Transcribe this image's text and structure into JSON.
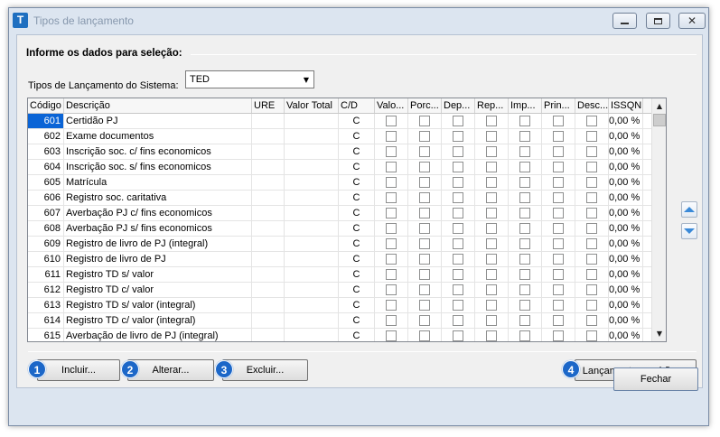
{
  "window": {
    "title": "Tipos de lançamento",
    "icon_letter": "T"
  },
  "form": {
    "group_title": "Informe os dados para seleção:",
    "select_label": "Tipos de Lançamento do Sistema:",
    "select_value": "TED"
  },
  "grid": {
    "columns": [
      "Código",
      "Descrição",
      "URE",
      "Valor Total",
      "C/D",
      "Valo...",
      "Porc...",
      "Dep...",
      "Rep...",
      "Imp...",
      "Prin...",
      "Desc...",
      "ISSQN"
    ],
    "rows": [
      {
        "code": "601",
        "desc": "Certidão PJ",
        "cd": "C",
        "issqn": "0,00 %"
      },
      {
        "code": "602",
        "desc": "Exame documentos",
        "cd": "C",
        "issqn": "0,00 %"
      },
      {
        "code": "603",
        "desc": "Inscrição soc. c/ fins economicos",
        "cd": "C",
        "issqn": "0,00 %"
      },
      {
        "code": "604",
        "desc": "Inscrição soc. s/ fins economicos",
        "cd": "C",
        "issqn": "0,00 %"
      },
      {
        "code": "605",
        "desc": "Matrícula",
        "cd": "C",
        "issqn": "0,00 %"
      },
      {
        "code": "606",
        "desc": "Registro soc. caritativa",
        "cd": "C",
        "issqn": "0,00 %"
      },
      {
        "code": "607",
        "desc": "Averbação PJ c/ fins economicos",
        "cd": "C",
        "issqn": "0,00 %"
      },
      {
        "code": "608",
        "desc": "Averbação PJ s/ fins economicos",
        "cd": "C",
        "issqn": "0,00 %"
      },
      {
        "code": "609",
        "desc": "Registro de livro de PJ (integral)",
        "cd": "C",
        "issqn": "0,00 %"
      },
      {
        "code": "610",
        "desc": "Registro de livro de PJ",
        "cd": "C",
        "issqn": "0,00 %"
      },
      {
        "code": "611",
        "desc": "Registro TD s/ valor",
        "cd": "C",
        "issqn": "0,00 %"
      },
      {
        "code": "612",
        "desc": "Registro TD c/ valor",
        "cd": "C",
        "issqn": "0,00 %"
      },
      {
        "code": "613",
        "desc": "Registro TD s/ valor (integral)",
        "cd": "C",
        "issqn": "0,00 %"
      },
      {
        "code": "614",
        "desc": "Registro TD c/ valor (integral)",
        "cd": "C",
        "issqn": "0,00 %"
      },
      {
        "code": "615",
        "desc": "Averbação de livro de PJ (integral)",
        "cd": "C",
        "issqn": "0,00 %"
      }
    ],
    "selected_row": 0
  },
  "buttons": {
    "incluir": {
      "badge": "1",
      "label": "Incluir..."
    },
    "alterar": {
      "badge": "2",
      "label": "Alterar..."
    },
    "excluir": {
      "badge": "3",
      "label": "Excluir..."
    },
    "lancamentos": {
      "badge": "4",
      "label": "Lançamentos padrões ▾"
    },
    "fechar": {
      "label": "Fechar"
    }
  },
  "icons": {
    "app": "app-icon",
    "minimize": "minimize-icon",
    "maximize": "maximize-icon",
    "close": "close-icon",
    "move_up": "arrow-up-icon",
    "move_down": "arrow-down-icon"
  },
  "colors": {
    "accent": "#1c67c8",
    "selection": "#0a64d6"
  }
}
